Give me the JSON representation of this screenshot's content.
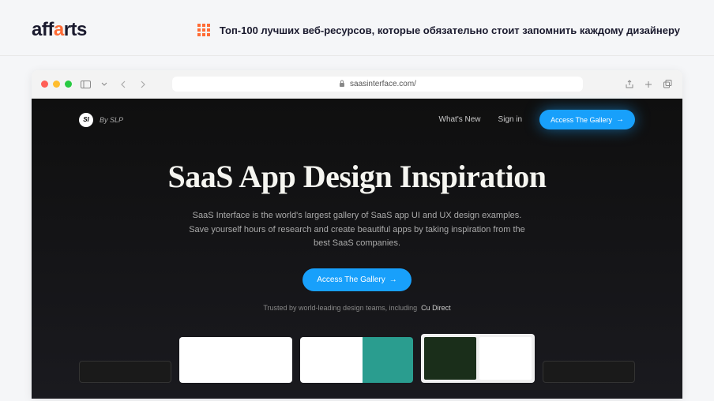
{
  "header": {
    "logo": "affarts",
    "tagline": "Топ-100 лучших веб-ресурсов, которые обязательно стоит запомнить каждому дизайнеру"
  },
  "browser": {
    "url": "saasinterface.com/"
  },
  "site": {
    "logo_badge": "SI",
    "logo_by": "By SLP",
    "nav": {
      "whats_new": "What's New",
      "sign_in": "Sign in",
      "cta": "Access The Gallery"
    },
    "hero": {
      "title": "SaaS App Design Inspiration",
      "subtitle": "SaaS Interface is the world's largest gallery of SaaS app UI and UX design examples. Save yourself hours of research and create beautiful apps by taking inspiration from the best SaaS companies.",
      "cta": "Access The Gallery",
      "trusted_prefix": "Trusted by world-leading design teams, including",
      "trusted_brand": "Cu Direct"
    }
  }
}
